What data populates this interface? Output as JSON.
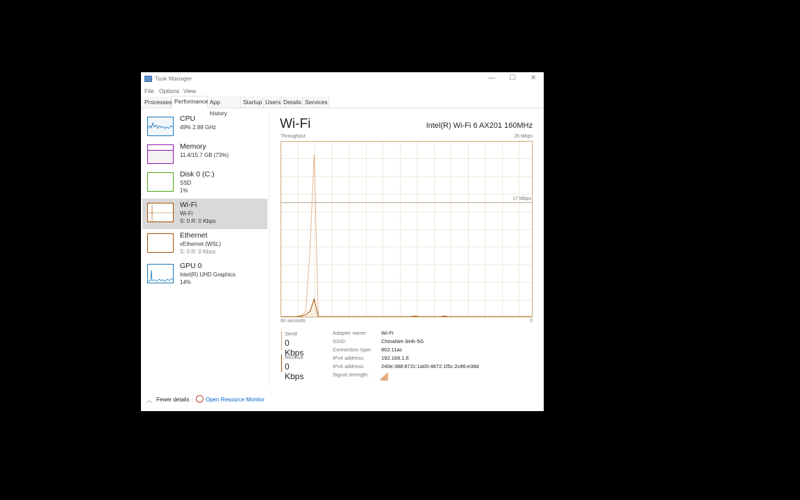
{
  "window": {
    "title": "Task Manager",
    "controls": {
      "minimize": "—",
      "maximize": "☐",
      "close": "✕"
    }
  },
  "menu": [
    "File",
    "Options",
    "View"
  ],
  "tabs": [
    {
      "label": "Processes",
      "active": false
    },
    {
      "label": "Performance",
      "active": true
    },
    {
      "label": "App history",
      "active": false
    },
    {
      "label": "Startup",
      "active": false
    },
    {
      "label": "Users",
      "active": false
    },
    {
      "label": "Details",
      "active": false
    },
    {
      "label": "Services",
      "active": false
    }
  ],
  "sidebar": {
    "items": [
      {
        "name": "CPU",
        "sub1": "49%  2.88 GHz",
        "sub2": "",
        "color": "#1779ba",
        "active": false
      },
      {
        "name": "Memory",
        "sub1": "11.4/15.7 GB (73%)",
        "sub2": "",
        "color": "#8b12ae",
        "active": false
      },
      {
        "name": "Disk 0 (C:)",
        "sub1": "SSD",
        "sub2": "1%",
        "color": "#4da60c",
        "active": false
      },
      {
        "name": "Wi-Fi",
        "sub1": "Wi-Fi",
        "sub2": "S: 0  R: 0 Kbps",
        "color": "#a74f01",
        "active": true
      },
      {
        "name": "Ethernet",
        "sub1": "vEthernet (WSL)",
        "sub2": "S: 0  R: 0 Kbps",
        "color": "#a74f01",
        "active": false
      },
      {
        "name": "GPU 0",
        "sub1": "Intel(R) UHD Graphics",
        "sub2": "14%",
        "color": "#1779ba",
        "active": false
      }
    ]
  },
  "main": {
    "title": "Wi-Fi",
    "adapter": "Intel(R) Wi-Fi 6 AX201 160MHz",
    "chart_label": "Throughput",
    "max_label": "26 Mbps",
    "mid_label": "17 Mbps",
    "x_left": "60 seconds",
    "x_right": "0",
    "send_label": "Send",
    "send_value": "0 Kbps",
    "receive_label": "Receive",
    "receive_value": "0 Kbps",
    "details": [
      {
        "key": "Adapter name:",
        "value": "Wi-Fi"
      },
      {
        "key": "SSID:",
        "value": "ChinaNet-3iHk-5G"
      },
      {
        "key": "Connection type:",
        "value": "802.11ac"
      },
      {
        "key": "IPv4 address:",
        "value": "192.168.1.6"
      },
      {
        "key": "IPv6 address:",
        "value": "240e:388:872c:1a00:4872:1f5c:2c86:e38d"
      },
      {
        "key": "Signal strength:",
        "value": ""
      }
    ],
    "signal_bars": 5,
    "signal_max": 5
  },
  "footer": {
    "fewer_details": "Fewer details",
    "open_resource_monitor": "Open Resource Monitor"
  },
  "colors": {
    "accent": "#a74f01",
    "grid": "#f2e8d8",
    "border": "#c9a877",
    "link": "#0066cc"
  },
  "chart_data": {
    "type": "line",
    "title": "Throughput",
    "xlabel": "60 seconds",
    "ylabel": "Mbps",
    "xlim": [
      60,
      0
    ],
    "ylim": [
      0,
      26
    ],
    "reference_line": 17,
    "x": [
      60,
      59,
      58,
      57,
      56,
      55,
      54,
      53,
      52,
      51,
      50,
      49,
      48,
      47,
      46,
      45,
      44,
      43,
      42,
      41,
      40,
      39,
      38,
      37,
      36,
      35,
      34,
      33,
      32,
      31,
      30,
      29,
      28,
      27,
      26,
      25,
      24,
      23,
      22,
      21,
      20,
      19,
      18,
      17,
      16,
      15,
      14,
      13,
      12,
      11,
      10,
      9,
      8,
      7,
      6,
      5,
      4,
      3,
      2,
      1,
      0
    ],
    "series": [
      {
        "name": "Receive",
        "style": "dotted",
        "values": [
          0,
          0,
          0,
          0,
          0.05,
          0.2,
          0.8,
          10,
          24,
          0,
          0,
          0,
          0,
          0,
          0,
          0,
          0,
          0,
          0,
          0,
          0,
          0,
          0,
          0,
          0,
          0,
          0,
          0,
          0,
          0,
          0,
          0,
          0.15,
          0,
          0,
          0,
          0,
          0,
          0,
          0.15,
          0,
          0,
          0,
          0,
          0,
          0,
          0,
          0,
          0,
          0,
          0,
          0,
          0,
          0,
          0,
          0,
          0,
          0,
          0,
          0,
          0
        ]
      },
      {
        "name": "Send",
        "style": "solid",
        "values": [
          0,
          0,
          0,
          0,
          0,
          0.1,
          0.3,
          0.8,
          2.6,
          0,
          0,
          0,
          0,
          0,
          0,
          0,
          0,
          0,
          0,
          0,
          0,
          0,
          0,
          0,
          0,
          0,
          0,
          0,
          0,
          0,
          0,
          0,
          0.05,
          0,
          0,
          0,
          0,
          0,
          0,
          0.05,
          0,
          0,
          0,
          0,
          0,
          0,
          0,
          0,
          0,
          0,
          0,
          0,
          0,
          0,
          0,
          0,
          0,
          0,
          0,
          0,
          0
        ]
      }
    ]
  }
}
